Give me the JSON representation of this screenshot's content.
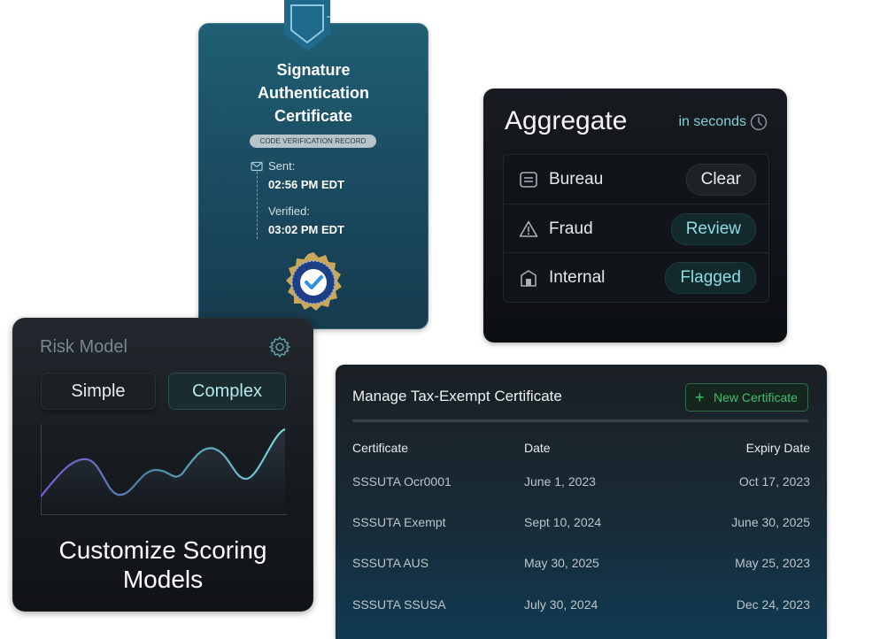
{
  "certificate_card": {
    "title_lines": [
      "Signature",
      "Authentication",
      "Certificate"
    ],
    "chip": "CODE VERIFICATION RECORD",
    "sent_label": "Sent:",
    "sent_time": "02:56 PM EDT",
    "verified_label": "Verified:",
    "verified_time": "03:02 PM EDT",
    "colors": {
      "card": "#1b4d63",
      "text": "#ffffff"
    }
  },
  "aggregate_card": {
    "title": "Aggregate",
    "subtitle": "in seconds",
    "rows": [
      {
        "name": "Bureau",
        "icon": "document-icon",
        "status": "Clear"
      },
      {
        "name": "Fraud",
        "icon": "warning-icon",
        "status": "Review"
      },
      {
        "name": "Internal",
        "icon": "building-icon",
        "status": "Flagged"
      }
    ],
    "colors": {
      "accent": "#8fdde3"
    }
  },
  "risk_card": {
    "title": "Risk Model",
    "options": [
      "Simple",
      "Complex"
    ],
    "selected": "Complex",
    "caption": "Customize Scoring Models"
  },
  "tax_table": {
    "title": "Manage Tax-Exempt Certificate",
    "new_button": "New Certificate",
    "columns": [
      "Certificate",
      "Date",
      "Expiry Date"
    ],
    "rows": [
      [
        "SSSUTA Ocr0001",
        "June 1, 2023",
        "Oct 17, 2023"
      ],
      [
        "SSSUTA Exempt",
        "Sept 10, 2024",
        "June 30, 2025"
      ],
      [
        "SSSUTA AUS",
        "May 30, 2025",
        "May 25, 2023"
      ],
      [
        "SSSUTA SSUSA",
        "July 30, 2024",
        "Dec 24, 2023"
      ]
    ],
    "colors": {
      "button": "#3fbf6f"
    }
  }
}
